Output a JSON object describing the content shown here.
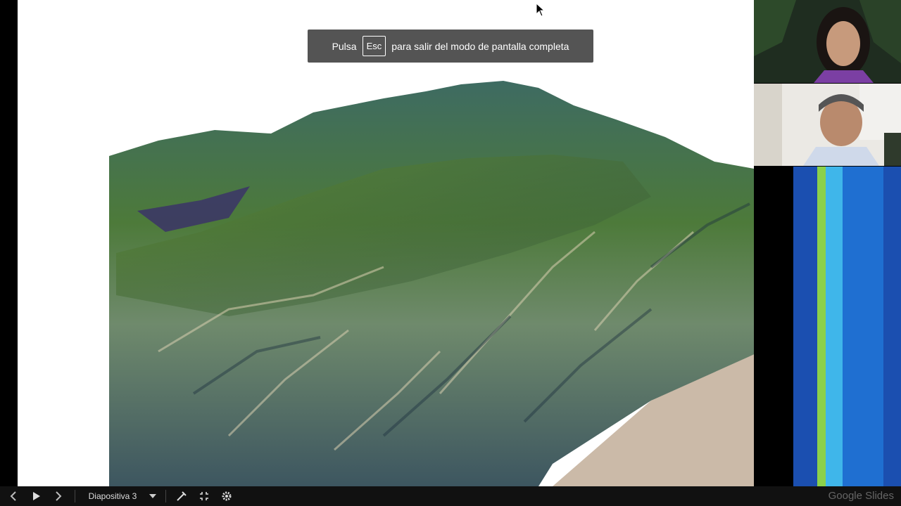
{
  "banner": {
    "prefix": "Pulsa",
    "key": "Esc",
    "suffix": "para salir del modo de pantalla completa"
  },
  "controls": {
    "prev_icon": "chevron-left-icon",
    "play_icon": "play-icon",
    "next_icon": "chevron-right-icon",
    "slide_label": "Diapositiva 3",
    "dropdown_icon": "caret-down-icon",
    "pointer_icon": "laser-pointer-icon",
    "exit_fullscreen_icon": "exit-fullscreen-icon",
    "settings_icon": "gear-icon"
  },
  "brand": "Google Slides",
  "colors": {
    "stripe_blue_dark": "#1b4fb0",
    "stripe_green": "#8bd14a",
    "stripe_cyan": "#3fb6ea",
    "stripe_blue_mid": "#1f6fd1"
  }
}
